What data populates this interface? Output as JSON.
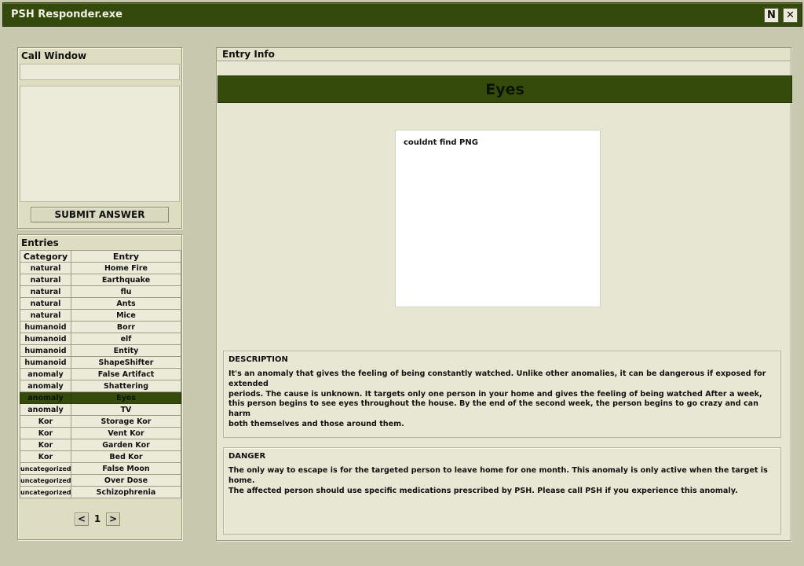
{
  "window": {
    "title": "PSH Responder.exe",
    "n_button": "N",
    "close_button": "✕"
  },
  "call_window": {
    "title": "Call Window",
    "input_value": "",
    "output_value": "",
    "submit_label": "SUBMIT ANSWER"
  },
  "entries": {
    "title": "Entries",
    "headers": {
      "category": "Category",
      "entry": "Entry"
    },
    "rows": [
      {
        "category": "natural",
        "entry": "Home Fire"
      },
      {
        "category": "natural",
        "entry": "Earthquake"
      },
      {
        "category": "natural",
        "entry": "flu"
      },
      {
        "category": "natural",
        "entry": "Ants"
      },
      {
        "category": "natural",
        "entry": "Mice"
      },
      {
        "category": "humanoid",
        "entry": "Borr"
      },
      {
        "category": "humanoid",
        "entry": "elf"
      },
      {
        "category": "humanoid",
        "entry": "Entity"
      },
      {
        "category": "humanoid",
        "entry": "ShapeShifter"
      },
      {
        "category": "anomaly",
        "entry": "False Artifact"
      },
      {
        "category": "anomaly",
        "entry": "Shattering"
      },
      {
        "category": "anomaly",
        "entry": "Eyes"
      },
      {
        "category": "anomaly",
        "entry": "TV"
      },
      {
        "category": "Kor",
        "entry": "Storage Kor"
      },
      {
        "category": "Kor",
        "entry": "Vent Kor"
      },
      {
        "category": "Kor",
        "entry": "Garden Kor"
      },
      {
        "category": "Kor",
        "entry": "Bed Kor"
      },
      {
        "category": "uncategorized",
        "entry": "False Moon"
      },
      {
        "category": "uncategorized",
        "entry": "Over Dose"
      },
      {
        "category": "uncategorized",
        "entry": "Schizophrenia"
      }
    ],
    "selected_entry": "Eyes",
    "pager": {
      "prev": "<",
      "page": "1",
      "next": ">"
    }
  },
  "entry_info": {
    "title": "Entry Info",
    "entry_name": "Eyes",
    "image_placeholder": "couldnt find PNG",
    "description_title": "DESCRIPTION",
    "description_text": "It's an anomaly that gives the feeling of being constantly watched. Unlike other anomalies, it can be dangerous if exposed for extended\nperiods. The cause is unknown. It targets only one person in your home and gives the feeling of being watched  After a week,\nthis person begins to see eyes throughout the house. By the end of the second week, the person begins to go crazy and can harm\nboth themselves and those around them.",
    "danger_title": "DANGER",
    "danger_text": "The only way to escape is for the targeted person to leave home for one month. This anomaly is only active when the target is home.\nThe affected person should use specific medications prescribed by PSH. Please call PSH if you experience this anomaly."
  },
  "colors": {
    "accent_dark_green": "#344b0c",
    "background": "#c7c8ad",
    "panel": "#deddc2"
  }
}
